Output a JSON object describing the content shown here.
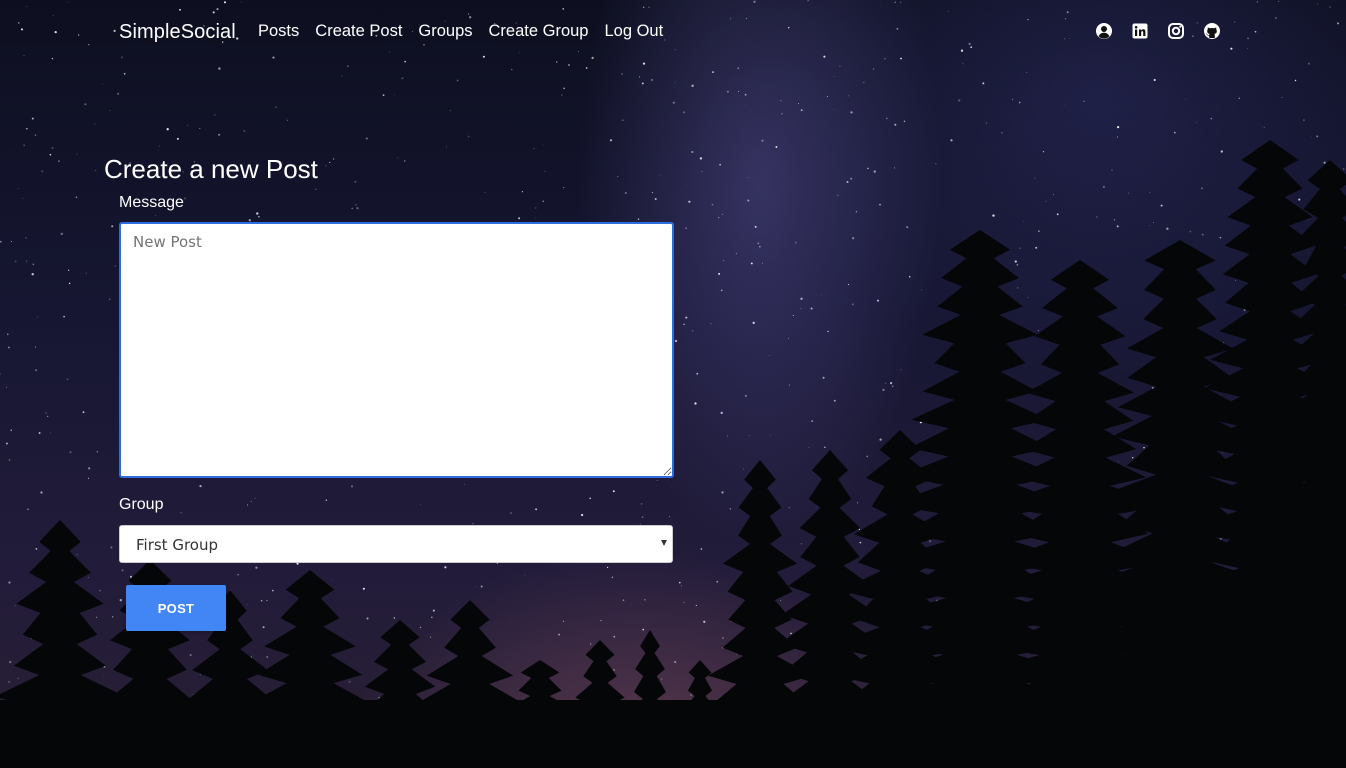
{
  "navbar": {
    "brand": "SimpleSocial",
    "links": [
      "Posts",
      "Create Post",
      "Groups",
      "Create Group",
      "Log Out"
    ],
    "social_icons": [
      "user-circle-icon",
      "linkedin-icon",
      "instagram-icon",
      "github-icon"
    ]
  },
  "form": {
    "title": "Create a new Post",
    "message_label": "Message",
    "message_placeholder": "New Post",
    "group_label": "Group",
    "group_selected": "First Group",
    "submit_label": "POST"
  },
  "colors": {
    "accent": "#4285f4",
    "input_focus_border": "#2e6de0",
    "text": "#ffffff"
  }
}
